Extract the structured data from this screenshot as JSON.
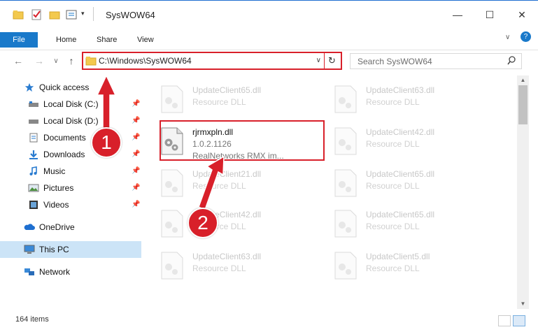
{
  "window": {
    "title": "SysWOW64",
    "minimize_label": "—",
    "maximize_label": "☐",
    "close_label": "✕"
  },
  "ribbon": {
    "file_label": "File",
    "tabs": [
      "Home",
      "Share",
      "View"
    ],
    "help_label": "?"
  },
  "nav": {
    "back": "←",
    "forward": "→",
    "recent": "∨",
    "up": "↑"
  },
  "address": {
    "path": "C:\\Windows\\SysWOW64",
    "refresh": "↻",
    "dropdown": "∨"
  },
  "search": {
    "placeholder": "Search SysWOW64",
    "icon": "🔍"
  },
  "sidebar": {
    "items": [
      {
        "label": "Quick access",
        "icon": "star-icon",
        "pinned": false
      },
      {
        "label": "Local Disk (C:)",
        "icon": "drive-icon",
        "pinned": true
      },
      {
        "label": "Local Disk (D:)",
        "icon": "drive-icon",
        "pinned": true
      },
      {
        "label": "Documents",
        "icon": "documents-icon",
        "pinned": true
      },
      {
        "label": "Downloads",
        "icon": "download-icon",
        "pinned": true
      },
      {
        "label": "Music",
        "icon": "music-icon",
        "pinned": true
      },
      {
        "label": "Pictures",
        "icon": "pictures-icon",
        "pinned": true
      },
      {
        "label": "Videos",
        "icon": "videos-icon",
        "pinned": true
      },
      {
        "label": "OneDrive",
        "icon": "cloud-icon",
        "pinned": false
      },
      {
        "label": "This PC",
        "icon": "computer-icon",
        "pinned": false
      },
      {
        "label": "Network",
        "icon": "network-icon",
        "pinned": false
      }
    ],
    "pin_glyph": "📌"
  },
  "files": {
    "left": [
      {
        "name": "UpdateClient65.dll",
        "desc": "Resource DLL"
      },
      {
        "name": "rjrmxpln.dll",
        "desc": "1.0.2.1126",
        "desc2": "RealNetworks RMX im..."
      },
      {
        "name": "UpdateClient21.dll",
        "desc": "Resource DLL"
      },
      {
        "name": "UpdateClient42.dll",
        "desc": "Resource DLL"
      },
      {
        "name": "UpdateClient63.dll",
        "desc": "Resource DLL"
      }
    ],
    "right": [
      {
        "name": "UpdateClient63.dll",
        "desc": "Resource DLL"
      },
      {
        "name": "UpdateClient42.dll",
        "desc": "Resource DLL"
      },
      {
        "name": "UpdateClient65.dll",
        "desc": "Resource DLL"
      },
      {
        "name": "UpdateClient65.dll",
        "desc": "Resource DLL"
      },
      {
        "name": "UpdateClient5.dll",
        "desc": "Resource DLL"
      }
    ]
  },
  "status": {
    "count": "164 items"
  },
  "annotations": {
    "badge1": "1",
    "badge2": "2",
    "color": "#d8202a"
  },
  "colors": {
    "accent": "#1979ca",
    "selection": "#cce4f7",
    "highlight": "#d8202a"
  }
}
